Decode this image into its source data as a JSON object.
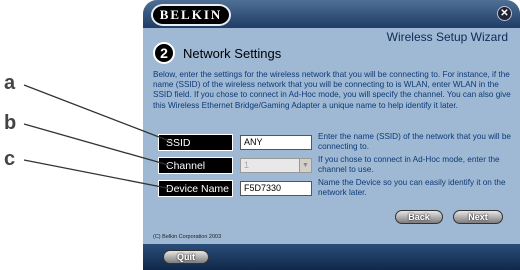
{
  "callouts": [
    "a",
    "b",
    "c"
  ],
  "window": {
    "logo": "BELKIN",
    "close_icon": "close-icon",
    "wizard_title": "Wireless Setup Wizard",
    "step_number": "2",
    "section_title": "Network Settings",
    "intro": "Below, enter the settings for the wireless network that you will be connecting to. For instance, if the name (SSID) of the wireless network that you will be connecting to is WLAN, enter WLAN in the SSID field. If you chose to connect in Ad-Hoc mode, you will specify the channel. You can also give this Wireless Ethernet Bridge/Gaming Adapter a unique name to help identify it later."
  },
  "form": {
    "ssid": {
      "label": "SSID",
      "value": "ANY",
      "help": "Enter the name (SSID) of the network that you will be connecting to."
    },
    "channel": {
      "label": "Channel",
      "value": "1",
      "help": "If you chose to connect in Ad-Hoc mode, enter the channel to use."
    },
    "device_name": {
      "label": "Device Name",
      "value": "F5D7330",
      "help": "Name the Device so you can easily identify it on the network later."
    }
  },
  "buttons": {
    "back": "Back",
    "next": "Next",
    "quit": "Quit"
  },
  "copyright": "(C) Belkin Corporation 2003",
  "colors": {
    "window_bg": "#9fb9d4",
    "bar": "#1f3d66",
    "text_blue": "#0d3a78"
  }
}
